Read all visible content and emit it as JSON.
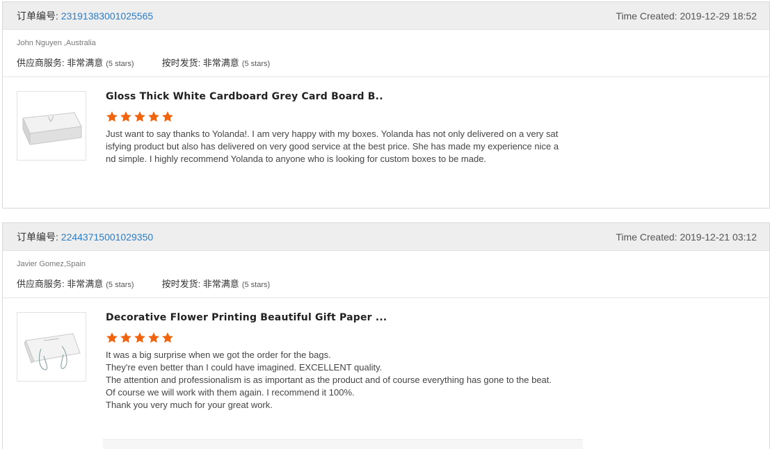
{
  "reviews": [
    {
      "order_label": "订单编号: ",
      "order_no": "23191383001025565",
      "time_label": "Time Created: ",
      "time_value": "2019-12-29 18:52",
      "buyer": "John Nguyen ,Australia",
      "supplier_label": "供应商服务: 非常满意",
      "supplier_stars": "(5 stars)",
      "shipping_label": "按时发货: 非常满意",
      "shipping_stars": "(5 stars)",
      "product_title": "Gloss Thick White Cardboard Grey Card Board B..",
      "rating": 5,
      "review_text": "Just want to say thanks to Yolanda!. I am very happy with my boxes. Yolanda has not only delivered on a very satisfying product but also has delivered on very good service at the best price. She has made my experience nice and simple. I highly recommend Yolanda to anyone who is looking for custom boxes to be made.",
      "image_icon": "white-gift-box-image"
    },
    {
      "order_label": "订单编号: ",
      "order_no": "22443715001029350",
      "time_label": "Time Created: ",
      "time_value": "2019-12-21 03:12",
      "buyer": "Javier Gomez,Spain",
      "supplier_label": "供应商服务: 非常满意",
      "supplier_stars": "(5 stars)",
      "shipping_label": "按时发货: 非常满意",
      "shipping_stars": "(5 stars)",
      "product_title": "Decorative Flower Printing Beautiful Gift Paper ...",
      "rating": 5,
      "review_text": "It was a big surprise when we got the order for the bags.\nThey're even better than I could have imagined. EXCELLENT quality.\nThe attention and professionalism is as important as the product and of course everything has gone to the beat.\nOf course we will work with them again. I recommend it 100%.\nThank you very much for your great work.",
      "image_icon": "white-paper-bag-image"
    }
  ],
  "colors": {
    "star": "#f0640f",
    "order_link": "#2b7cc4",
    "header_bg": "#eeeeee"
  }
}
